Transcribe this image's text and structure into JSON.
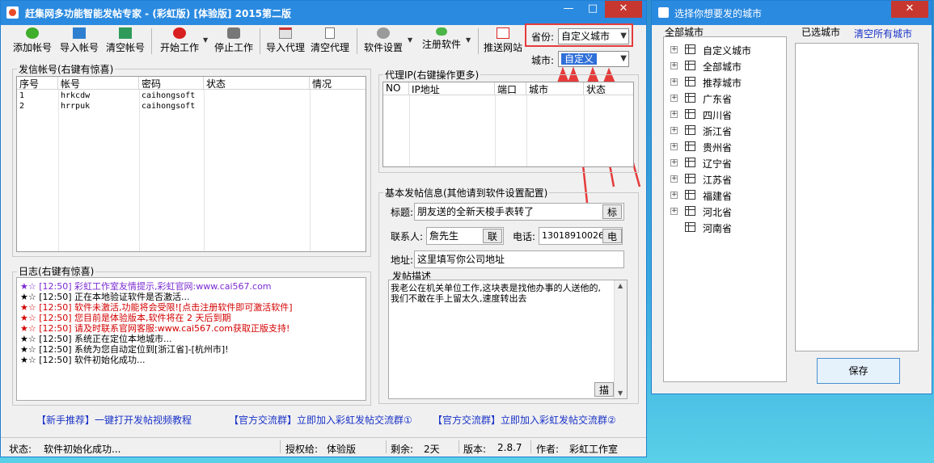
{
  "main": {
    "title": "赶集网多功能智能发帖专家 - (彩虹版) [体验版]     2015第二版",
    "window_buttons": {
      "minimize": "—",
      "maximize": "□",
      "close": "✕"
    },
    "toolbar": [
      {
        "label": "添加帐号",
        "icon": "add-icon"
      },
      {
        "label": "导入帐号",
        "icon": "import-icon"
      },
      {
        "label": "清空帐号",
        "icon": "clear-icon"
      },
      {
        "label": "开始工作",
        "icon": "play-icon"
      },
      {
        "label": "停止工作",
        "icon": "stop-icon"
      },
      {
        "label": "导入代理",
        "icon": "import-proxy-icon"
      },
      {
        "label": "清空代理",
        "icon": "trash-icon"
      },
      {
        "label": "软件设置",
        "icon": "settings-icon"
      },
      {
        "label": "注册软件",
        "icon": "key-icon"
      },
      {
        "label": "推送网站",
        "icon": "push-icon"
      }
    ],
    "province_label": "省份:",
    "province_value": "自定义城市",
    "city_label": "城市:",
    "city_value": "自定义",
    "accounts": {
      "title": "发信帐号(右键有惊喜)",
      "headers": [
        "序号",
        "帐号",
        "密码",
        "状态",
        "情况"
      ],
      "rows": [
        [
          "1",
          "hrkcdw",
          "caihongsoft",
          "",
          ""
        ],
        [
          "2",
          "hrrpuk",
          "caihongsoft",
          "",
          ""
        ]
      ]
    },
    "proxy": {
      "title": "代理IP(右键操作更多)",
      "headers": [
        "NO",
        "IP地址",
        "端口",
        "城市",
        "状态"
      ]
    },
    "post": {
      "title": "基本发帖信息(其他请到软件设置配置)",
      "title_label": "标题:",
      "title_value": "朋友送的全新天梭手表转了",
      "title_btn": "标",
      "contact_label": "联系人:",
      "contact_value": "詹先生",
      "contact_btn": "联",
      "phone_label": "电话:",
      "phone_value": "13018910026",
      "phone_btn": "电",
      "address_label": "地址:",
      "address_value": "这里填写你公司地址",
      "desc_label": "发帖描述",
      "desc_value": "我老公在机关单位工作,这块表是找他办事的人送他的,我们不敢在手上留太久,速度转出去",
      "desc_btn": "描"
    },
    "log": {
      "title": "日志(右键有惊喜)",
      "lines": [
        {
          "stars": "★☆",
          "text": "[12:50] 彩虹工作室友情提示,彩虹官网:www.cai567.com",
          "color": "#7a2bd1"
        },
        {
          "stars": "★☆",
          "text": "[12:50] 正在本地验证软件是否激活...",
          "color": "#000000"
        },
        {
          "stars": "★☆",
          "text": "[12:50] 软件未激活,功能将会受限![点击注册软件即可激活软件]",
          "color": "#d40000"
        },
        {
          "stars": "★☆",
          "text": "[12:50] 您目前是体验版本,软件将在 2 天后到期",
          "color": "#d40000"
        },
        {
          "stars": "★☆",
          "text": "[12:50] 请及时联系官网客服:www.cai567.com获取正版支持!",
          "color": "#d40000"
        },
        {
          "stars": "★☆",
          "text": "[12:50] 系统正在定位本地城市...",
          "color": "#000000"
        },
        {
          "stars": "★☆",
          "text": "[12:50] 系统为您自动定位到[浙江省]-[杭州市]!",
          "color": "#000000"
        },
        {
          "stars": "★☆",
          "text": "[12:50] 软件初始化成功...",
          "color": "#000000"
        }
      ]
    },
    "links": [
      "【新手推荐】一键打开发帖视频教程",
      "【官方交流群】立即加入彩虹发帖交流群①",
      "【官方交流群】立即加入彩虹发帖交流群②"
    ],
    "status": {
      "label": "状态:",
      "value": "软件初始化成功...",
      "auth_label": "授权给:",
      "auth_value": "体验版",
      "remain_label": "剩余:",
      "remain_value": "2天",
      "version_label": "版本:",
      "version_value": "2.8.7",
      "author_label": "作者:",
      "author_value": "彩虹工作室"
    }
  },
  "city_dialog": {
    "title": "选择你想要发的城市",
    "all_label": "全部城市",
    "selected_label": "已选城市",
    "clear_link": "清空所有城市",
    "save_label": "保存",
    "tree": [
      "自定义城市",
      "全部城市",
      "推荐城市",
      "广东省",
      "四川省",
      "浙江省",
      "贵州省",
      "辽宁省",
      "江苏省",
      "福建省",
      "河北省",
      "河南省"
    ]
  },
  "colors": {
    "accent": "#2a8ae0",
    "annotation": "#e53b3b",
    "link": "#1a33c8"
  }
}
